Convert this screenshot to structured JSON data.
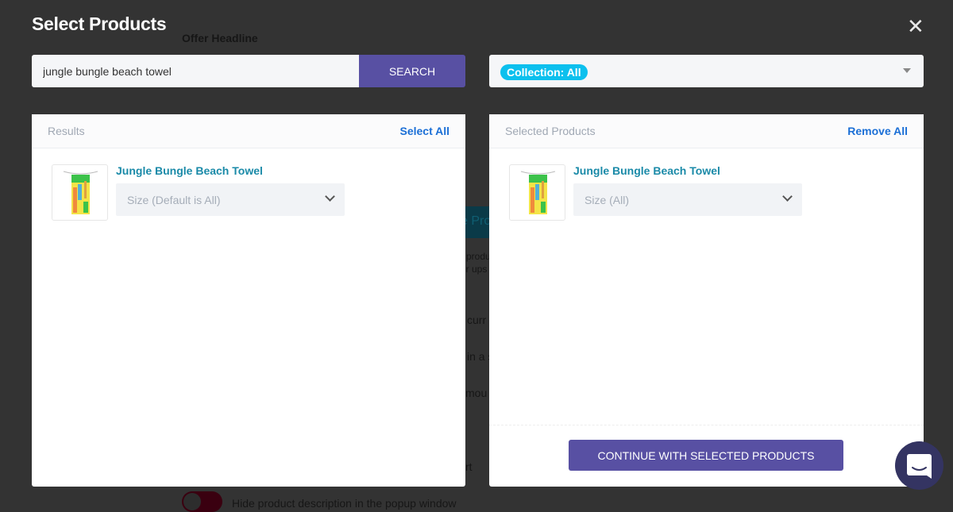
{
  "background": {
    "offer_headline": "Offer Headline",
    "fragments": [
      "produ",
      "ir ups",
      "curr",
      "in a s",
      "mou",
      "rt"
    ],
    "teal_button_fragment": "e Pro",
    "toggle_label": "Hide product description in the popup window"
  },
  "modal": {
    "title": "Select Products",
    "close_icon": "close-icon",
    "search": {
      "value": "jungle bungle beach towel",
      "button": "SEARCH"
    },
    "collection": {
      "pill": "Collection: All"
    },
    "results": {
      "label": "Results",
      "action": "Select All",
      "items": [
        {
          "name": "Jungle Bungle Beach Towel",
          "size_placeholder": "Size (Default is All)"
        }
      ]
    },
    "selected": {
      "label": "Selected Products",
      "action": "Remove All",
      "items": [
        {
          "name": "Jungle Bungle Beach Towel",
          "size_placeholder": "Size (All)"
        }
      ],
      "continue": "CONTINUE WITH SELECTED PRODUCTS"
    }
  },
  "colors": {
    "accent": "#5850a3",
    "pill": "#0cc0ee",
    "link": "#1b6fd6",
    "product_link": "#1a8aa8"
  }
}
